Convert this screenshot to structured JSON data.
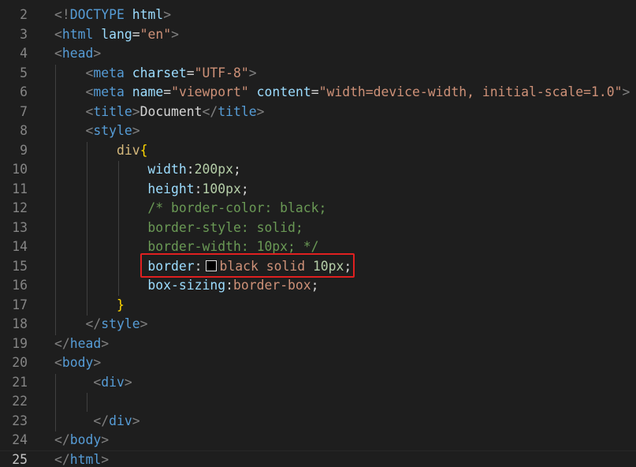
{
  "editor": {
    "highlight_color": "#e02020",
    "swatch_color": "#000000",
    "current_line": "25",
    "lines": [
      {
        "n": "2",
        "parts": [
          [
            "t-tag",
            "<!"
          ],
          [
            "t-doc",
            "DOCTYPE"
          ],
          [
            "t-punc",
            " "
          ],
          [
            "t-attr",
            "html"
          ],
          [
            "t-tag",
            ">"
          ]
        ]
      },
      {
        "n": "3",
        "parts": [
          [
            "t-tag",
            "<"
          ],
          [
            "t-name",
            "html"
          ],
          [
            "t-punc",
            " "
          ],
          [
            "t-attr",
            "lang"
          ],
          [
            "t-punc",
            "="
          ],
          [
            "t-str",
            "\"en\""
          ],
          [
            "t-tag",
            ">"
          ]
        ]
      },
      {
        "n": "4",
        "parts": [
          [
            "t-tag",
            "<"
          ],
          [
            "t-name",
            "head"
          ],
          [
            "t-tag",
            ">"
          ]
        ]
      },
      {
        "n": "5",
        "parts": [
          [
            "t-punc",
            "    "
          ],
          [
            "t-tag",
            "<"
          ],
          [
            "t-name",
            "meta"
          ],
          [
            "t-punc",
            " "
          ],
          [
            "t-attr",
            "charset"
          ],
          [
            "t-punc",
            "="
          ],
          [
            "t-str",
            "\"UTF-8\""
          ],
          [
            "t-tag",
            ">"
          ]
        ]
      },
      {
        "n": "6",
        "parts": [
          [
            "t-punc",
            "    "
          ],
          [
            "t-tag",
            "<"
          ],
          [
            "t-name",
            "meta"
          ],
          [
            "t-punc",
            " "
          ],
          [
            "t-attr",
            "name"
          ],
          [
            "t-punc",
            "="
          ],
          [
            "t-str",
            "\"viewport\""
          ],
          [
            "t-punc",
            " "
          ],
          [
            "t-attr",
            "content"
          ],
          [
            "t-punc",
            "="
          ],
          [
            "t-str",
            "\"width=device-width, initial-scale=1.0\""
          ],
          [
            "t-tag",
            ">"
          ]
        ]
      },
      {
        "n": "7",
        "parts": [
          [
            "t-punc",
            "    "
          ],
          [
            "t-tag",
            "<"
          ],
          [
            "t-name",
            "title"
          ],
          [
            "t-tag",
            ">"
          ],
          [
            "t-punc",
            "Document"
          ],
          [
            "t-tag",
            "</"
          ],
          [
            "t-name",
            "title"
          ],
          [
            "t-tag",
            ">"
          ]
        ]
      },
      {
        "n": "8",
        "parts": [
          [
            "t-punc",
            "    "
          ],
          [
            "t-tag",
            "<"
          ],
          [
            "t-name",
            "style"
          ],
          [
            "t-tag",
            ">"
          ]
        ]
      },
      {
        "n": "9",
        "parts": [
          [
            "t-punc",
            "        "
          ],
          [
            "t-sel",
            "div"
          ],
          [
            "t-brace",
            "{"
          ]
        ]
      },
      {
        "n": "10",
        "parts": [
          [
            "t-punc",
            "            "
          ],
          [
            "t-prop",
            "width"
          ],
          [
            "t-punc",
            ":"
          ],
          [
            "t-num",
            "200px"
          ],
          [
            "t-punc",
            ";"
          ]
        ]
      },
      {
        "n": "11",
        "parts": [
          [
            "t-punc",
            "            "
          ],
          [
            "t-prop",
            "height"
          ],
          [
            "t-punc",
            ":"
          ],
          [
            "t-num",
            "100px"
          ],
          [
            "t-punc",
            ";"
          ]
        ]
      },
      {
        "n": "12",
        "parts": [
          [
            "t-punc",
            "            "
          ],
          [
            "t-cmt",
            "/* border-color: black;"
          ]
        ]
      },
      {
        "n": "13",
        "parts": [
          [
            "t-punc",
            "            "
          ],
          [
            "t-cmt",
            "border-style: solid;"
          ]
        ]
      },
      {
        "n": "14",
        "parts": [
          [
            "t-punc",
            "            "
          ],
          [
            "t-cmt",
            "border-width: 10px; */"
          ]
        ]
      },
      {
        "n": "15",
        "parts": [
          [
            "t-punc",
            "            "
          ],
          [
            "t-prop",
            "border"
          ],
          [
            "t-punc",
            ":"
          ],
          [
            "swatch",
            ""
          ],
          [
            "t-val",
            "black solid "
          ],
          [
            "t-num",
            "10px"
          ],
          [
            "t-punc",
            ";"
          ]
        ]
      },
      {
        "n": "16",
        "parts": [
          [
            "t-punc",
            "            "
          ],
          [
            "t-prop",
            "box-sizing"
          ],
          [
            "t-punc",
            ":"
          ],
          [
            "t-val",
            "border-box"
          ],
          [
            "t-punc",
            ";"
          ]
        ]
      },
      {
        "n": "17",
        "parts": [
          [
            "t-punc",
            "        "
          ],
          [
            "t-brace",
            "}"
          ]
        ]
      },
      {
        "n": "18",
        "parts": [
          [
            "t-punc",
            "    "
          ],
          [
            "t-tag",
            "</"
          ],
          [
            "t-name",
            "style"
          ],
          [
            "t-tag",
            ">"
          ]
        ]
      },
      {
        "n": "19",
        "parts": [
          [
            "t-tag",
            "</"
          ],
          [
            "t-name",
            "head"
          ],
          [
            "t-tag",
            ">"
          ]
        ]
      },
      {
        "n": "20",
        "parts": [
          [
            "t-tag",
            "<"
          ],
          [
            "t-name",
            "body"
          ],
          [
            "t-tag",
            ">"
          ]
        ]
      },
      {
        "n": "21",
        "parts": [
          [
            "t-punc",
            "     "
          ],
          [
            "t-tag",
            "<"
          ],
          [
            "t-name",
            "div"
          ],
          [
            "t-tag",
            ">"
          ]
        ]
      },
      {
        "n": "22",
        "parts": []
      },
      {
        "n": "23",
        "parts": [
          [
            "t-punc",
            "     "
          ],
          [
            "t-tag",
            "</"
          ],
          [
            "t-name",
            "div"
          ],
          [
            "t-tag",
            ">"
          ]
        ]
      },
      {
        "n": "24",
        "parts": [
          [
            "t-tag",
            "</"
          ],
          [
            "t-name",
            "body"
          ],
          [
            "t-tag",
            ">"
          ]
        ]
      },
      {
        "n": "25",
        "parts": [
          [
            "t-tag",
            "</"
          ],
          [
            "t-name",
            "html"
          ],
          [
            "t-tag",
            ">"
          ]
        ]
      }
    ]
  }
}
